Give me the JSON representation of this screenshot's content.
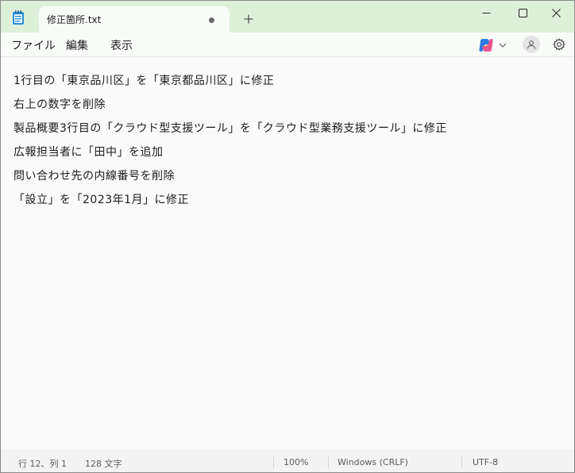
{
  "window": {
    "tab_title": "修正箇所.txt",
    "new_tab_label": "+"
  },
  "menu": {
    "file": "ファイル",
    "edit": "編集",
    "view": "表示"
  },
  "icons": {
    "app": "notepad-icon",
    "unsaved": "unsaved-dot-icon",
    "copilot": "copilot-icon",
    "profile": "profile-icon",
    "settings": "gear-icon",
    "minimize": "minimize-icon",
    "maximize": "maximize-icon",
    "close": "close-icon"
  },
  "document": {
    "lines": [
      "1行目の「東京品川区」を「東京都品川区」に修正",
      "右上の数字を削除",
      "製品概要3行目の「クラウド型支援ツール」を「クラウド型業務支援ツール」に修正",
      "広報担当者に「田中」を追加",
      "問い合わせ先の内線番号を削除",
      "「設立」を「2023年1月」に修正"
    ]
  },
  "status": {
    "position": "行 12、列 1",
    "char_count": "128 文字",
    "zoom": "100%",
    "line_ending": "Windows (CRLF)",
    "encoding": "UTF-8"
  },
  "colors": {
    "titlebar_bg": "#dff0da",
    "tab_bg": "#f9fbf9",
    "editor_bg": "#fafafa",
    "status_bg": "#f3f3f3"
  }
}
